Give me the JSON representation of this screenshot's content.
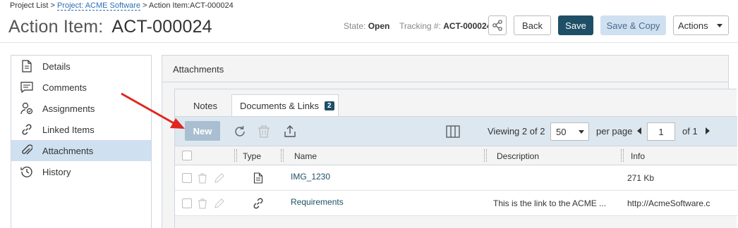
{
  "breadcrumb": {
    "project_list": "Project List",
    "sep1": " > ",
    "project": "Project: ACME Software",
    "sep2": " > ",
    "current": "Action Item:ACT-000024"
  },
  "header": {
    "title": "Action Item:",
    "number": "ACT-000024",
    "state_label": "State:",
    "state_value": "Open",
    "tracking_label": "Tracking #:",
    "tracking_value": "ACT-000024",
    "back_label": "Back",
    "save_label": "Save",
    "save_copy_label": "Save & Copy",
    "actions_label": "Actions"
  },
  "sidebar": {
    "items": [
      {
        "label": "Details",
        "icon": "document-icon"
      },
      {
        "label": "Comments",
        "icon": "comment-icon"
      },
      {
        "label": "Assignments",
        "icon": "user-assign-icon"
      },
      {
        "label": "Linked Items",
        "icon": "link-icon"
      },
      {
        "label": "Attachments",
        "icon": "paperclip-icon",
        "active": true
      },
      {
        "label": "History",
        "icon": "history-icon"
      }
    ]
  },
  "panel": {
    "title": "Attachments",
    "tabs": {
      "notes": "Notes",
      "docs": "Documents & Links",
      "docs_count": "2"
    },
    "toolbar": {
      "new_label": "New",
      "viewing_prefix": "Viewing ",
      "viewing_range": "2 of 2",
      "per_page_value": "50",
      "per_page_label": "per page",
      "page_value": "1",
      "of_label": "of ",
      "page_total": "1"
    },
    "columns": {
      "type": "Type",
      "name": "Name",
      "description": "Description",
      "info": "Info"
    },
    "rows": [
      {
        "type_icon": "file-icon",
        "name": "IMG_1230",
        "description": "",
        "info": "271 Kb"
      },
      {
        "type_icon": "link-icon",
        "name": "Requirements",
        "description": "This is the link to the ACME ...",
        "info": "http://AcmeSoftware.c"
      }
    ]
  },
  "colors": {
    "primary": "#1f4f66",
    "link": "#2a6fb5",
    "active_bg": "#cfe0f1",
    "toolbar_bg": "#dce7f0",
    "arrow": "#e0261e"
  }
}
